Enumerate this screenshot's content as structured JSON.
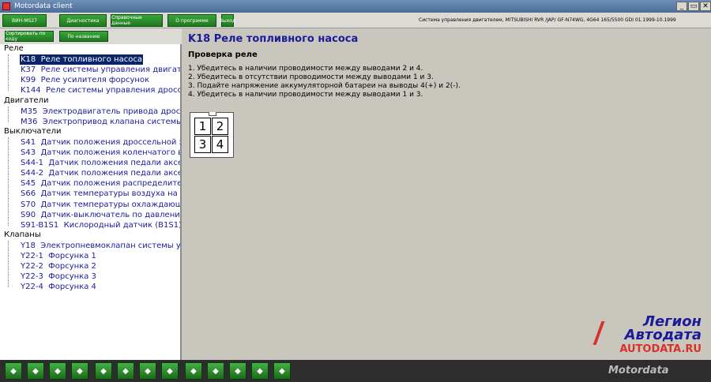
{
  "window": {
    "title": "Motordata client",
    "buttons": [
      "_",
      "▭",
      "✕"
    ]
  },
  "toolbar": {
    "tabs": [
      "ВИН-MS27",
      "Диагностика",
      "Справочные данные",
      "О программе",
      "Выход"
    ],
    "vehicle_info": "Система управления двигателем, MITSUBISHI RVR /JAP/ GF-N74WG, 4G64 165/5500 GDI 01.1999-10.1999"
  },
  "sort": {
    "by_code": "Сортировать по коду",
    "by_name": "По названию"
  },
  "tree": {
    "groups": [
      {
        "label": "Реле",
        "items": [
          {
            "code": "K18",
            "name": "Реле топливного насоса",
            "selected": true
          },
          {
            "code": "K37",
            "name": "Реле системы управления двигателем"
          },
          {
            "code": "K99",
            "name": "Реле усилителя форсунок"
          },
          {
            "code": "K144",
            "name": "Реле системы управления дроссельной"
          }
        ]
      },
      {
        "label": "Двигатели",
        "items": [
          {
            "code": "M35",
            "name": "Электродвигатель привода дроссельной"
          },
          {
            "code": "M36",
            "name": "Электропривод клапана системы EGR"
          }
        ]
      },
      {
        "label": "Выключатели",
        "items": [
          {
            "code": "S41",
            "name": "Датчик положения дроссельной заслонки"
          },
          {
            "code": "S43",
            "name": "Датчик положения коленчатого вала"
          },
          {
            "code": "S44-1",
            "name": "Датчик положения педали акселератора"
          },
          {
            "code": "S44-2",
            "name": "Датчик положения педали акселератора"
          },
          {
            "code": "S45",
            "name": "Датчик положения распределительного"
          },
          {
            "code": "S66",
            "name": "Датчик температуры воздуха на впуске"
          },
          {
            "code": "S70",
            "name": "Датчик температуры охлаждающей жидкости"
          },
          {
            "code": "S90",
            "name": "Датчик-выключатель по давлению в"
          },
          {
            "code": "S91-B1S1",
            "name": "Кислородный датчик (B1S1)"
          }
        ]
      },
      {
        "label": "Клапаны",
        "items": [
          {
            "code": "Y18",
            "name": "Электропневмоклапан системы улавливания"
          },
          {
            "code": "Y22-1",
            "name": "Форсунка 1"
          },
          {
            "code": "Y22-2",
            "name": "Форсунка 2"
          },
          {
            "code": "Y22-3",
            "name": "Форсунка 3"
          },
          {
            "code": "Y22-4",
            "name": "Форсунка 4"
          }
        ]
      }
    ]
  },
  "content": {
    "heading": "K18 Реле топливного насоса",
    "subheading": "Проверка реле",
    "steps": [
      "1. Убедитесь в наличии проводимости между выводами 2 и 4.",
      "2. Убедитесь в отсутствии проводимости между выводами 1 и 3.",
      "3. Подайте напряжение аккумуляторной батареи на выводы 4(+) и 2(-).",
      "4. Убедитесь в наличии проводимости между выводами 1 и 3."
    ],
    "connector_pins": [
      "1",
      "2",
      "3",
      "4"
    ]
  },
  "logo": {
    "line1": "Легион",
    "line2": "Автодата",
    "line3": "AUTODATA.RU"
  },
  "bottom": {
    "brand": "Motordata",
    "icon_count": 15
  }
}
